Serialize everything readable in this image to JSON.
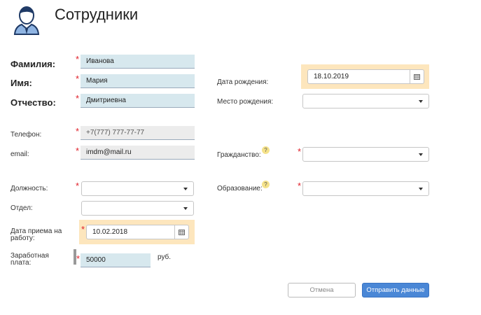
{
  "header": {
    "title": "Сотрудники",
    "icon": "employee-avatar-icon"
  },
  "fields": {
    "surname": {
      "label": "Фамилия:",
      "value": "Иванова"
    },
    "name": {
      "label": "Имя:",
      "value": "Мария"
    },
    "patronymic": {
      "label": "Отчество:",
      "value": "Дмитриевна"
    },
    "phone": {
      "label": "Телефон:",
      "value": "+7(777) 777-77-77"
    },
    "email": {
      "label": "email:",
      "value": "imdm@mail.ru"
    },
    "position": {
      "label": "Должность:",
      "value": ""
    },
    "department": {
      "label": "Отдел:",
      "value": ""
    },
    "hire_date": {
      "label": "Дата приема на работу:",
      "value": "10.02.2018"
    },
    "salary": {
      "label": "Заработная плата:",
      "value": "50000",
      "unit": "руб."
    },
    "birth_date": {
      "label": "Дата рождения:",
      "value": "18.10.2019"
    },
    "birth_place": {
      "label": "Место рождения:",
      "value": ""
    },
    "citizenship": {
      "label": "Гражданство:",
      "value": ""
    },
    "education": {
      "label": "Образование:",
      "value": ""
    }
  },
  "help_glyph": "?",
  "required_mark": "*",
  "buttons": {
    "cancel": "Отмена",
    "submit": "Отправить данные"
  },
  "colors": {
    "accent": "#4a87d6",
    "required": "#e0202a",
    "highlight": "#fde6bd",
    "filled": "#d7e8ee"
  }
}
